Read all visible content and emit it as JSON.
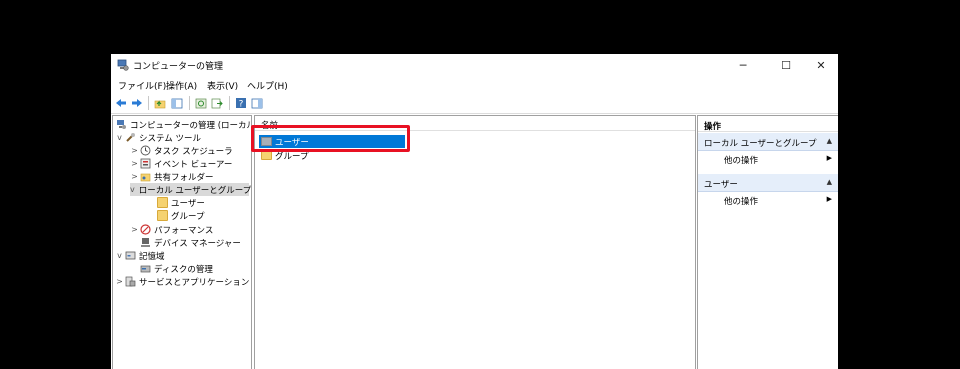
{
  "window": {
    "title": "コンピューターの管理",
    "minimize": "─",
    "maximize": "☐",
    "close": "✕"
  },
  "menu": [
    "ファイル(F)",
    "操作(A)",
    "表示(V)",
    "ヘルプ(H)"
  ],
  "tree": [
    {
      "label": "コンピューターの管理 (ローカル)",
      "icon": "computer-management-icon"
    },
    {
      "label": "システム ツール",
      "icon": "tools-icon",
      "expander": "v"
    },
    {
      "label": "タスク スケジューラ",
      "icon": "clock-icon",
      "expander": ">"
    },
    {
      "label": "イベント ビューアー",
      "icon": "event-viewer-icon",
      "expander": ">"
    },
    {
      "label": "共有フォルダー",
      "icon": "shared-folder-icon",
      "expander": ">"
    },
    {
      "label": "ローカル ユーザーとグループ",
      "icon": "users-icon",
      "expander": "v"
    },
    {
      "label": "ユーザー",
      "icon": "folder-icon"
    },
    {
      "label": "グループ",
      "icon": "folder-icon"
    },
    {
      "label": "パフォーマンス",
      "icon": "performance-icon",
      "expander": ">"
    },
    {
      "label": "デバイス マネージャー",
      "icon": "device-manager-icon"
    },
    {
      "label": "記憶域",
      "icon": "storage-icon",
      "expander": "v"
    },
    {
      "label": "ディスクの管理",
      "icon": "disk-icon"
    },
    {
      "label": "サービスとアプリケーション",
      "icon": "services-icon",
      "expander": ">"
    }
  ],
  "list": {
    "column_name": "名前",
    "items": [
      {
        "label": "ユーザー"
      },
      {
        "label": "グループ"
      }
    ]
  },
  "actions": {
    "title": "操作",
    "section1": {
      "label": "ローカル ユーザーとグループ",
      "item": "他の操作"
    },
    "section2": {
      "label": "ユーザー",
      "item": "他の操作"
    },
    "expand_arrow": "▲",
    "more_arrow": "▶"
  },
  "colors": {
    "selection": "#0078d7",
    "highlight_border": "#e81123",
    "section_bg": "#e5eefa"
  }
}
